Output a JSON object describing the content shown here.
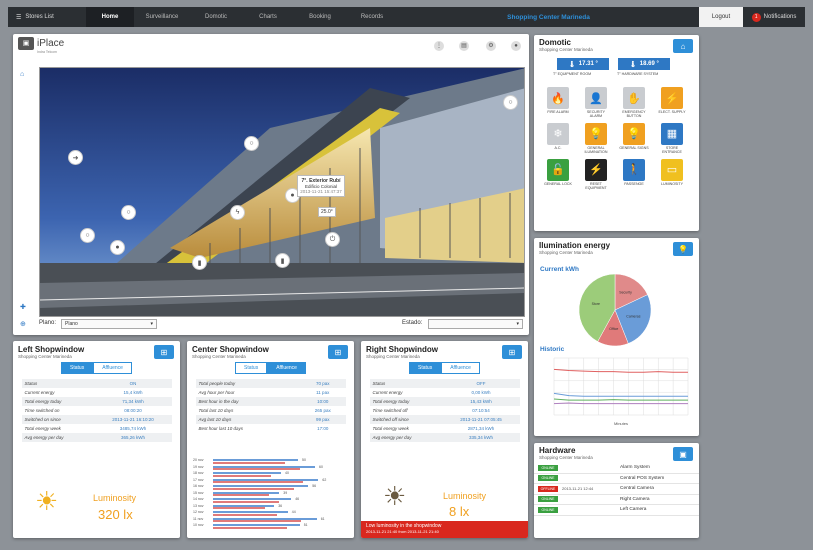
{
  "topbar": {
    "menu": "Stores List",
    "nav": [
      "Home",
      "Surveillance",
      "Domotic",
      "Charts",
      "Booking",
      "Records"
    ],
    "center": "Shopping Center Marineda",
    "logout": "Logout",
    "notifications": "Notifications",
    "badge": "1"
  },
  "main": {
    "logo": "iPlace",
    "logo_sub": "Indra Telcom",
    "tooltip_title": "7°. Exterior Rubí",
    "tooltip_sub": "Edificio Colonial",
    "tooltip_date": "2013-11-21 15:47:37",
    "tooltip_value": "25.0°",
    "plano_label": "Plano:",
    "plano_value": "Plano",
    "estado_label": "Estado:",
    "estado_value": ""
  },
  "left": {
    "title": "Left Shopwindow",
    "sub": "Shopping Center Marineda",
    "tab1": "Status",
    "tab2": "Affluence",
    "rows": [
      [
        "Status",
        "ON"
      ],
      [
        "Current energy",
        "15,4 kWh"
      ],
      [
        "Total energy today",
        "71,34 kWh"
      ],
      [
        "Time switched on",
        "08:00:20"
      ],
      [
        "Switched on since",
        "2013-11-21 16:10:20"
      ],
      [
        "Total energy week",
        "3485,74 kWh"
      ],
      [
        "Avg energy per day",
        "365,26 kWh"
      ]
    ],
    "lum_label": "Luminosity",
    "lum_value": "320 lx"
  },
  "center": {
    "title": "Center Shopwindow",
    "sub": "Shopping Center Marineda",
    "tab1": "Status",
    "tab2": "Affluence",
    "rows": [
      [
        "Total people today",
        "70 pax"
      ],
      [
        "Avg hour per hour",
        "11 pax"
      ],
      [
        "Best hour in the day",
        "10:00"
      ],
      [
        "Total last 10 days",
        "265 pax"
      ],
      [
        "Avg last 10 days",
        "99 pax"
      ],
      [
        "Best hour last 10 days",
        "17:00"
      ]
    ],
    "bars": [
      {
        "label": "20 nov",
        "v": 50
      },
      {
        "label": "19 nov",
        "v": 60
      },
      {
        "label": "18 nov",
        "v": 40
      },
      {
        "label": "17 nov",
        "v": 62
      },
      {
        "label": "16 nov",
        "v": 56
      },
      {
        "label": "15 nov",
        "v": 39
      },
      {
        "label": "14 nov",
        "v": 46
      },
      {
        "label": "13 nov",
        "v": 36
      },
      {
        "label": "12 nov",
        "v": 44
      },
      {
        "label": "11 nov",
        "v": 61
      },
      {
        "label": "10 nov",
        "v": 51
      }
    ]
  },
  "right": {
    "title": "Right Shopwindow",
    "sub": "Shopping Center Marineda",
    "tab1": "Status",
    "tab2": "Affluence",
    "rows": [
      [
        "Status",
        "OFF"
      ],
      [
        "Current energy",
        "0,00 kWh"
      ],
      [
        "Total energy today",
        "15,43 kWh"
      ],
      [
        "Time switched off",
        "07:10:54"
      ],
      [
        "Switched off since",
        "2013-11-21 07:05:45"
      ],
      [
        "Total energy week",
        "2871,34 kWh"
      ],
      [
        "Avg energy per day",
        "335,34 kWh"
      ]
    ],
    "lum_label": "Luminosity",
    "lum_value": "8 lx",
    "alert": "Low luminosity in the shopwindow",
    "alert_sub": "2013-11-21 21:40 from 2013-11-21 21:40"
  },
  "domotic": {
    "title": "Domotic",
    "sub": "Shopping Center Marineda",
    "temp1": "17.31 °",
    "temp1_label": "T° EQUIPMENT ROOM",
    "temp2": "18.69 °",
    "temp2_label": "T° HARDWARE SYSTEM",
    "icons": [
      {
        "label": "FIRE ALARM",
        "color": "#c9ccd0"
      },
      {
        "label": "SECURITY ALARM",
        "color": "#c9ccd0"
      },
      {
        "label": "EMERGENCY BUTTON",
        "color": "#c9ccd0"
      },
      {
        "label": "ELECT. SUPPLY",
        "color": "#f0a020"
      },
      {
        "label": "A.C.",
        "color": "#c9ccd0"
      },
      {
        "label": "GENERAL ILUMINATION",
        "color": "#f0a020"
      },
      {
        "label": "GENERAL SIGNS",
        "color": "#f0a020"
      },
      {
        "label": "STORE ENTRANCE",
        "color": "#2e78c4"
      },
      {
        "label": "GENERAL LOCK",
        "color": "#3aa040"
      },
      {
        "label": "RESET EQUIPMENT",
        "color": "#222222"
      },
      {
        "label": "PASSENGE",
        "color": "#2e78c4"
      },
      {
        "label": "LUMINOSITY",
        "color": "#f0c020"
      }
    ]
  },
  "energy": {
    "title": "Ilumination energy",
    "sub": "Shopping Center Marineda",
    "current": "Current kWh",
    "historic": "Historic",
    "pie": [
      {
        "name": "Security",
        "v": 18,
        "color": "#e08a8a"
      },
      {
        "name": "Cameras",
        "v": 26,
        "color": "#6a9cd8"
      },
      {
        "name": "Office",
        "v": 14,
        "color": "#e07a7a"
      },
      {
        "name": "Store",
        "v": 42,
        "color": "#9ccc7a"
      }
    ]
  },
  "chart_data": {
    "type": "line",
    "x": [
      1,
      2,
      3,
      4,
      5,
      6,
      7,
      8,
      9,
      10
    ],
    "series": [
      {
        "values": [
          8.0,
          7.8,
          7.7,
          7.6,
          7.6,
          7.5,
          7.5,
          7.6,
          7.5,
          7.5
        ],
        "color": "#e06060"
      },
      {
        "values": [
          3.8,
          3.4,
          3.3,
          3.3,
          3.3,
          3.3,
          3.3,
          3.3,
          3.3,
          3.3
        ],
        "color": "#6a9cd8"
      },
      {
        "values": [
          2.8,
          2.6,
          2.6,
          2.6,
          2.7,
          2.6,
          2.6,
          2.6,
          2.6,
          2.6
        ],
        "color": "#60b060"
      },
      {
        "values": [
          2.0,
          2.1,
          2.0,
          2.0,
          2.0,
          2.0,
          2.0,
          2.0,
          2.0,
          2.0
        ],
        "color": "#b080c0"
      }
    ],
    "ylim": [
      0,
      10
    ],
    "xlabel": "Minutes"
  },
  "hardware": {
    "title": "Hardware",
    "sub": "Shopping Center Marineda",
    "rows": [
      {
        "status": "ONLINE",
        "color": "#3aa040",
        "date": "",
        "name": "Alarm System"
      },
      {
        "status": "ONLINE",
        "color": "#3aa040",
        "date": "",
        "name": "Central POS System"
      },
      {
        "status": "OFFLINE",
        "color": "#d9281e",
        "date": "2013-11-21 12:44",
        "name": "Central Camera"
      },
      {
        "status": "ONLINE",
        "color": "#3aa040",
        "date": "",
        "name": "Right Camera"
      },
      {
        "status": "ONLINE",
        "color": "#3aa040",
        "date": "",
        "name": "Left Camera"
      }
    ]
  }
}
